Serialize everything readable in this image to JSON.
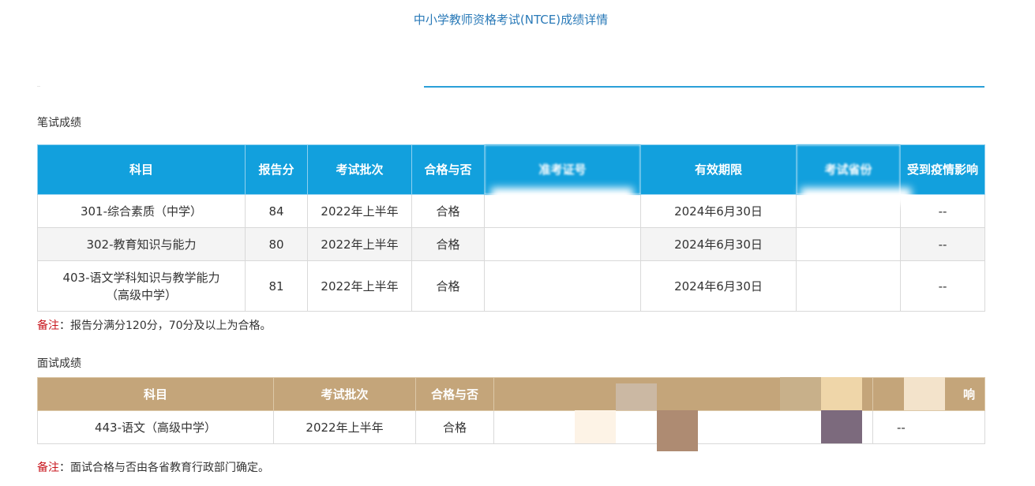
{
  "page": {
    "title": "中小学教师资格考试(NTCE)成绩详情"
  },
  "written": {
    "section_label": "笔试成绩",
    "headers": [
      "科目",
      "报告分",
      "考试批次",
      "合格与否",
      "准考证号",
      "有效期限",
      "考试省份",
      "受到疫情影响"
    ],
    "rows": [
      {
        "subject": "301-综合素质（中学）",
        "score": "84",
        "batch": "2022年上半年",
        "result": "合格",
        "ticket": "",
        "valid": "2024年6月30日",
        "province": "",
        "covid": "--"
      },
      {
        "subject": "302-教育知识与能力",
        "score": "80",
        "batch": "2022年上半年",
        "result": "合格",
        "ticket": "",
        "valid": "2024年6月30日",
        "province": "",
        "covid": "--"
      },
      {
        "subject": "403-语文学科知识与教学能力（高级中学）",
        "score": "81",
        "batch": "2022年上半年",
        "result": "合格",
        "ticket": "",
        "valid": "2024年6月30日",
        "province": "",
        "covid": "--"
      }
    ],
    "note_key": "备注",
    "note_text": "：报告分满分120分，70分及以上为合格。"
  },
  "interview": {
    "section_label": "面试成绩",
    "headers": [
      "科目",
      "考试批次",
      "合格与否",
      "",
      "响"
    ],
    "rows": [
      {
        "subject": "443-语文（高级中学）",
        "batch": "2022年上半年",
        "result": "合格",
        "hidden": "",
        "covid": "--"
      }
    ],
    "note_key": "备注",
    "note_text": "：面试合格与否由各省教育行政部门确定。"
  },
  "colors": {
    "written_header": "#12a0dd",
    "interview_header": "#c4a57a",
    "title": "#2a7ab8",
    "note_key": "#c8161d"
  }
}
